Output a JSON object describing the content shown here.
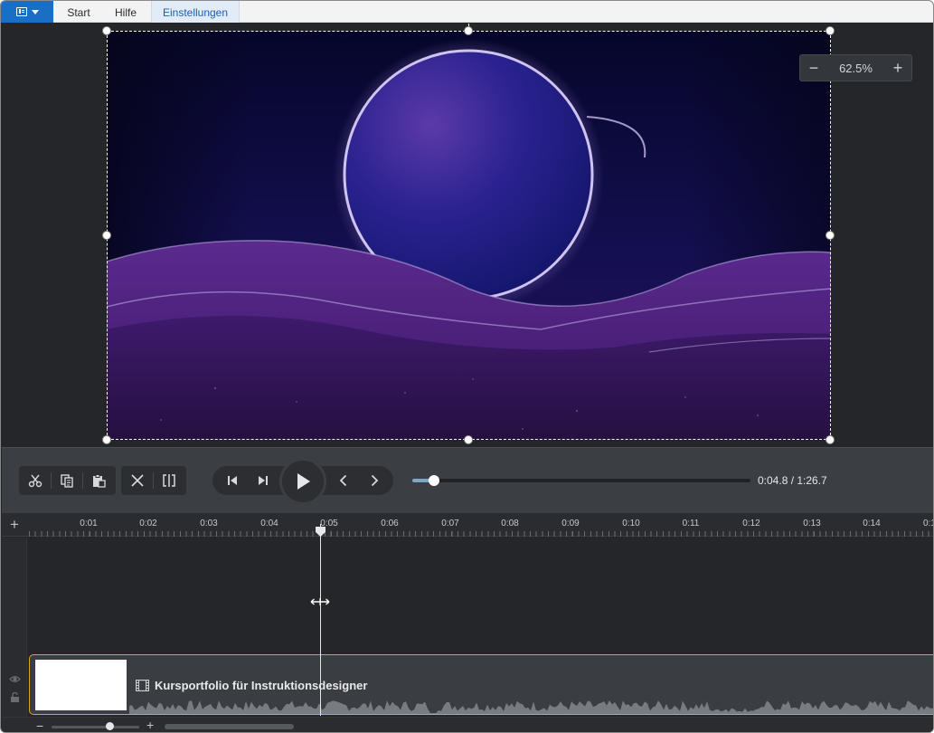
{
  "ribbon": {
    "app_menu_icon": "app-menu-icon",
    "tabs": [
      {
        "label": "Start"
      },
      {
        "label": "Hilfe"
      },
      {
        "label": "Einstellungen"
      }
    ],
    "active_tab": "Einstellungen"
  },
  "stage": {
    "zoom": {
      "minus": "−",
      "value": "62.5%",
      "plus": "+"
    },
    "canvas_colors": {
      "sky_top": "#08082c",
      "sky_bottom": "#1a1256",
      "dune": "#4a1f7e",
      "moon": "#1a1a78",
      "glow": "#d8cdf4"
    }
  },
  "playback": {
    "edit_tools": [
      "cut-icon",
      "copy-icon",
      "paste-icon"
    ],
    "split_tools": [
      "delete-icon",
      "split-icon"
    ],
    "transport": [
      "skip-start-icon",
      "skip-end-icon",
      "play-icon",
      "previous-frame-icon",
      "next-frame-icon"
    ],
    "progress": 0.063,
    "timecode": "0:04.8 / 1:26.7"
  },
  "timeline": {
    "add_track": "+",
    "ticks": [
      "0:01",
      "0:02",
      "0:03",
      "0:04",
      "0:05",
      "0:06",
      "0:07",
      "0:08",
      "0:09",
      "0:10",
      "0:11",
      "0:12",
      "0:13",
      "0:14",
      "0:1"
    ],
    "clip": {
      "title": "Kursportfolio für Instruktionsdesigner",
      "border_color": "#d9a623"
    },
    "footer": {
      "zoom_minus": "−",
      "zoom_plus": "+"
    }
  }
}
